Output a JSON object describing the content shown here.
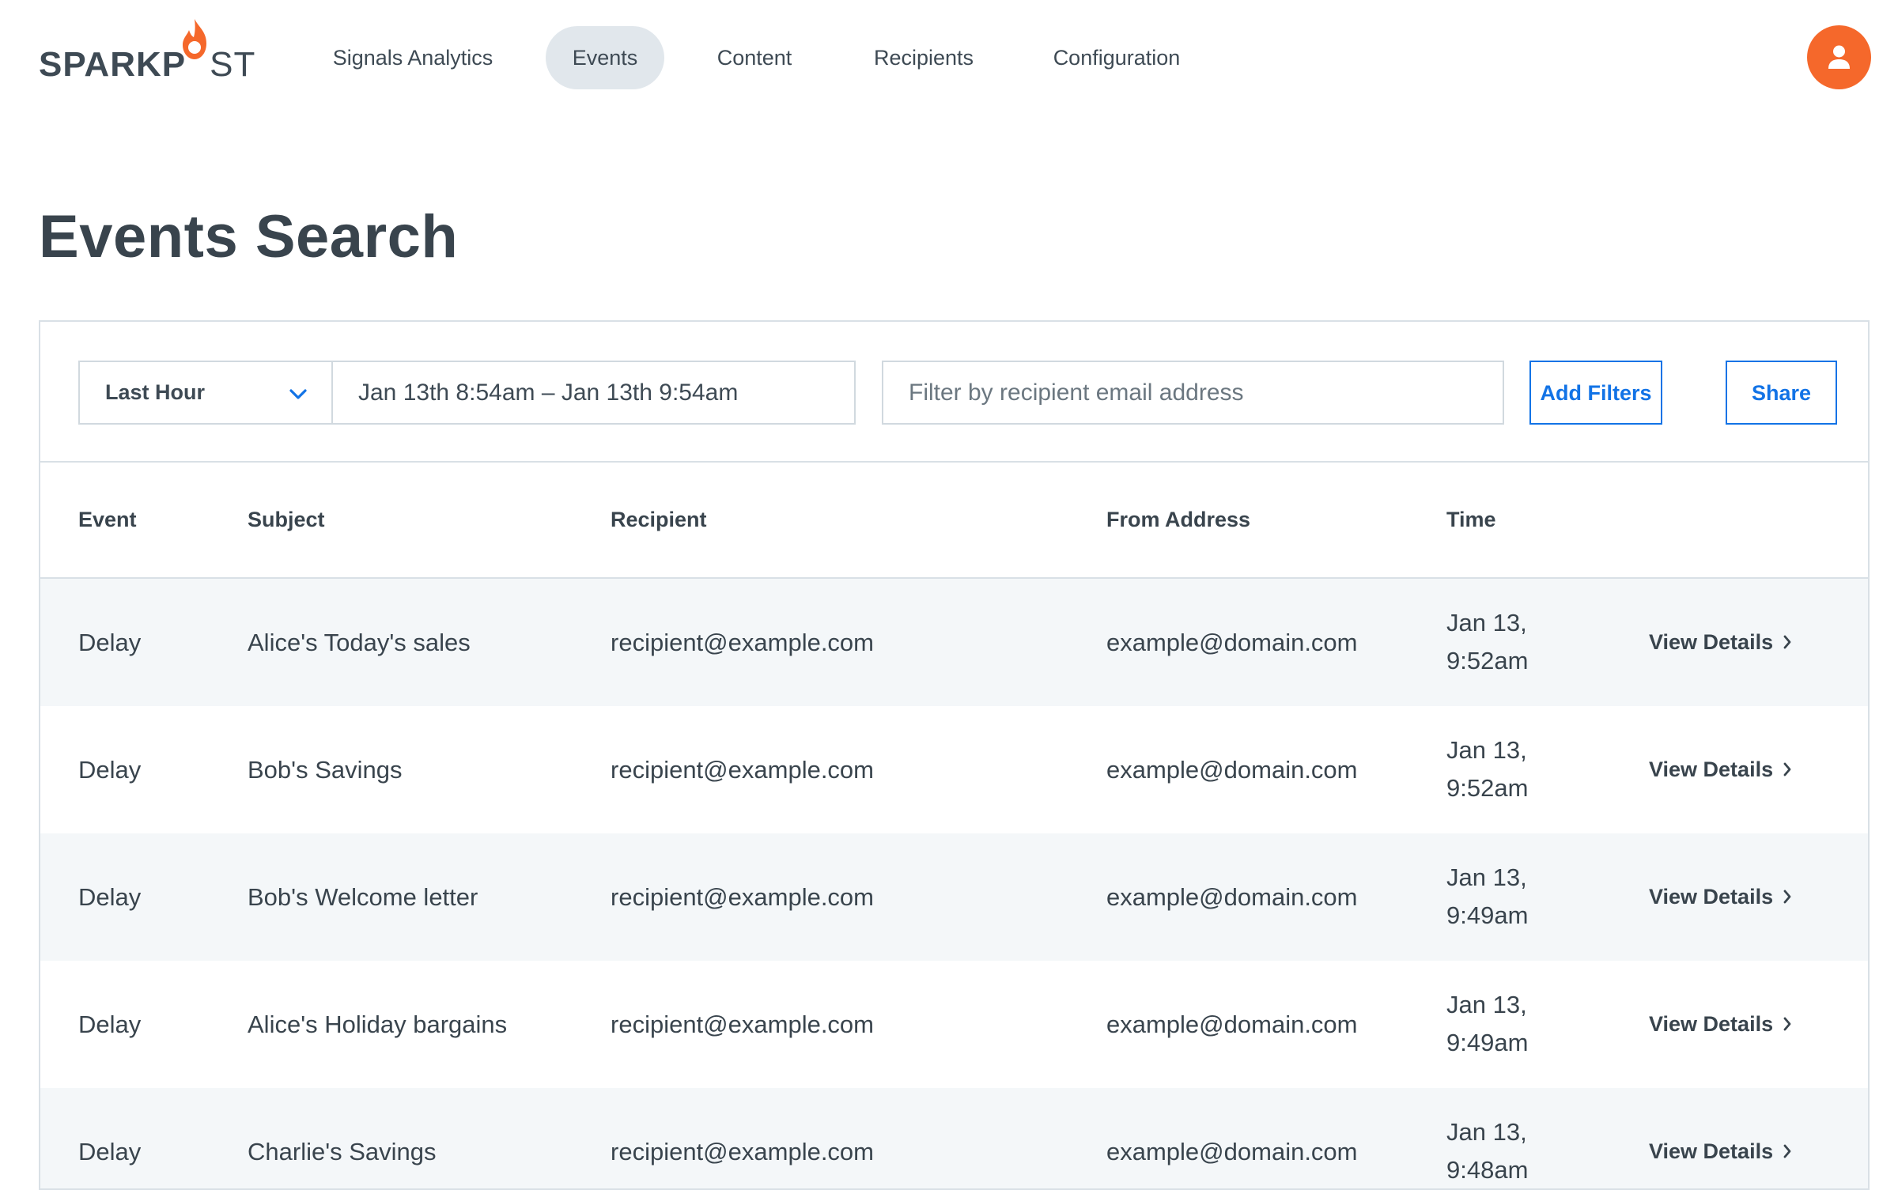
{
  "brand": {
    "name_bold": "SPARKP",
    "name_light": "ST",
    "accent_color": "#f5682b"
  },
  "nav": {
    "items": [
      {
        "label": "Signals Analytics",
        "active": false
      },
      {
        "label": "Events",
        "active": true
      },
      {
        "label": "Content",
        "active": false
      },
      {
        "label": "Recipients",
        "active": false
      },
      {
        "label": "Configuration",
        "active": false
      }
    ],
    "avatar_icon": "user-icon"
  },
  "page": {
    "title": "Events Search"
  },
  "filters": {
    "range_label": "Last Hour",
    "range_icon": "chevron-down-icon",
    "date_range": "Jan 13th 8:54am – Jan 13th 9:54am",
    "email_placeholder": "Filter by recipient email address",
    "email_value": "",
    "add_filters_label": "Add Filters",
    "share_label": "Share",
    "button_color": "#1273e6"
  },
  "table": {
    "headers": [
      "Event",
      "Subject",
      "Recipient",
      "From Address",
      "Time"
    ],
    "view_details_label": "View Details",
    "rows": [
      {
        "event": "Delay",
        "subject": "Alice's Today's sales",
        "recipient": "recipient@example.com",
        "from": "example@domain.com",
        "time_date": "Jan 13,",
        "time_clock": "9:52am"
      },
      {
        "event": "Delay",
        "subject": "Bob's Savings",
        "recipient": "recipient@example.com",
        "from": "example@domain.com",
        "time_date": "Jan 13,",
        "time_clock": "9:52am"
      },
      {
        "event": "Delay",
        "subject": "Bob's Welcome letter",
        "recipient": "recipient@example.com",
        "from": "example@domain.com",
        "time_date": "Jan 13,",
        "time_clock": "9:49am"
      },
      {
        "event": "Delay",
        "subject": "Alice's Holiday bargains",
        "recipient": "recipient@example.com",
        "from": "example@domain.com",
        "time_date": "Jan 13,",
        "time_clock": "9:49am"
      },
      {
        "event": "Delay",
        "subject": "Charlie's Savings",
        "recipient": "recipient@example.com",
        "from": "example@domain.com",
        "time_date": "Jan 13,",
        "time_clock": "9:48am"
      }
    ]
  }
}
